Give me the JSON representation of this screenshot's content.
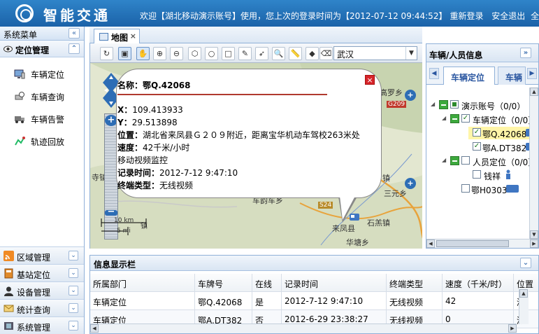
{
  "header": {
    "logo_text": "智能交通",
    "welcome": "欢迎【湖北移动演示账号】使用，您上次的登录时间为【2012-07-12 09:44:52】",
    "relogin": "重新登录",
    "logout": "安全退出",
    "fullscreen": "全屏"
  },
  "sidebar": {
    "title": "系统菜单",
    "collapse": "«",
    "section": "定位管理",
    "section_toggle": "⌃",
    "items": [
      {
        "label": "车辆定位"
      },
      {
        "label": "车辆查询"
      },
      {
        "label": "车辆告警"
      },
      {
        "label": "轨迹回放"
      }
    ],
    "accordions": [
      {
        "label": "区域管理"
      },
      {
        "label": "基站定位"
      },
      {
        "label": "设备管理"
      },
      {
        "label": "统计查询"
      },
      {
        "label": "系统管理"
      }
    ],
    "expand": "⌄"
  },
  "tabs": {
    "map_tab": "地图",
    "close": "×"
  },
  "map": {
    "city": "武汉",
    "labels": {
      "gaoluo": "高罗乡",
      "road_g209": "G209",
      "zhen1": "镇",
      "zhen2": "镇",
      "sanyuan": "三元乡",
      "chezhou": "车韵车乡",
      "s24": "S24",
      "laifeng": "来凤县",
      "shiyang": "石羔镇",
      "huatang": "华塘乡",
      "si": "寺镇",
      "xiang": "乡",
      "scale_km": "10 km",
      "scale_mi": "5 mi",
      "zhenlabel": "镇"
    }
  },
  "popup": {
    "title": "名称：鄂Q.42068",
    "close": "×",
    "x_label": "X：",
    "x_value": "109.413933",
    "y_label": "Y：",
    "y_value": "29.513898",
    "location_label": "位置：",
    "location_value": "湖北省来凤县Ｇ２０９附近，距离宝华机动车驾校263米处",
    "speed_label": "速度：",
    "speed_value": "42千米/小时",
    "monitor": "移动视频监控",
    "time_label": "记录时间：",
    "time_value": "2012-7-12 9:47:10",
    "term_label": "终端类型：",
    "term_value": "无线视频"
  },
  "right_panel": {
    "title": "车辆/人员信息",
    "collapse": "»",
    "tab1": "车辆定位",
    "tab2": "车辆",
    "left_arrow": "◀",
    "right_arrow": "▶",
    "tree": {
      "root": "演示账号（0/0）",
      "vehicle_group": "车辆定位（0/0）",
      "v1": "鄂Q.42068",
      "v2": "鄂A.DT382",
      "person_group": "人员定位（0/0）",
      "p1": "钱祥",
      "v3": "鄂H0303"
    }
  },
  "info_panel": {
    "title": "信息显示栏",
    "collapse": "⌄",
    "columns": [
      "所属部门",
      "车牌号",
      "在线",
      "记录时间",
      "终端类型",
      "速度（千米/时）",
      "位置"
    ],
    "rows": [
      [
        "车辆定位",
        "鄂Q.42068",
        "是",
        "2012-7-12 9:47:10",
        "无线视频",
        "42",
        "湖"
      ],
      [
        "车辆定位",
        "鄂A.DT382",
        "否",
        "2012-6-29 23:38:27",
        "无线视频",
        "0",
        "湖"
      ]
    ]
  },
  "colors": {
    "header": "#1b62a8",
    "accent": "#8fb0d8",
    "popup_rule": "#b03a2e",
    "close_red": "#d6242a"
  }
}
